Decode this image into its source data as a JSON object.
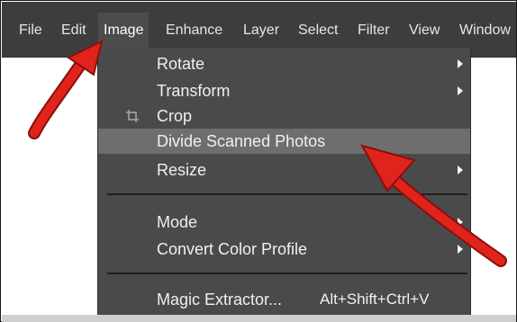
{
  "menubar": {
    "items": [
      {
        "label": "File"
      },
      {
        "label": "Edit"
      },
      {
        "label": "Image"
      },
      {
        "label": "Enhance"
      },
      {
        "label": "Layer"
      },
      {
        "label": "Select"
      },
      {
        "label": "Filter"
      },
      {
        "label": "View"
      },
      {
        "label": "Window"
      }
    ],
    "active": "Image"
  },
  "dropdown": {
    "items": [
      {
        "label": "Rotate",
        "submenu": true
      },
      {
        "label": "Transform",
        "submenu": true
      },
      {
        "label": "Crop",
        "icon": "crop-icon"
      },
      {
        "label": "Divide Scanned Photos",
        "highlighted": true
      },
      {
        "label": "Resize",
        "submenu": true
      },
      {
        "label": "Mode",
        "submenu": true
      },
      {
        "label": "Convert Color Profile",
        "submenu": true
      },
      {
        "label": "Magic Extractor...",
        "shortcut": "Alt+Shift+Ctrl+V"
      }
    ]
  },
  "colors": {
    "menubar_bg": "#3d3d3d",
    "dropdown_bg": "#4a4a4a",
    "highlight_bg": "#6e6e6e",
    "annotation_arrow": "#e0241b"
  }
}
